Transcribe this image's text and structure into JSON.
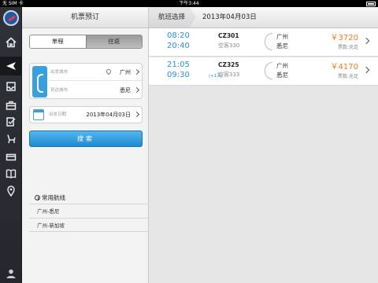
{
  "status_bar": {
    "carrier": "无 SIM 卡",
    "time": "下午3:44"
  },
  "rail": {
    "items": [
      "home-icon",
      "plane-icon",
      "inbox-icon",
      "briefcase-icon",
      "checklist-icon",
      "seat-icon",
      "card-icon",
      "book-icon",
      "location-icon"
    ],
    "user_icon": "user-icon"
  },
  "left_panel": {
    "title": "机票预订",
    "trip_type": {
      "one_way": "单程",
      "round_trip": "往返",
      "selected": "单程"
    },
    "origin": {
      "label": "出发城市",
      "value": "广州"
    },
    "destination": {
      "label": "到达城市",
      "value": "悉尼"
    },
    "departure_date": {
      "label": "出发日期",
      "value": "2013年04月03日"
    },
    "search_label": "搜索",
    "favorites": {
      "title": "常用航线",
      "items": [
        "广州-悉尼",
        "广州-新加坡"
      ]
    }
  },
  "right_panel": {
    "tag": "航班选择",
    "date": "2013年04月03日",
    "flights": [
      {
        "depart": "08:20",
        "arrive": "20:40",
        "nextday": "",
        "code": "CZ301",
        "model": "空客330",
        "from": "广州",
        "to": "悉尼",
        "price": "￥3720",
        "tickets": "票数:充足"
      },
      {
        "depart": "21:05",
        "arrive": "09:30",
        "nextday": "(+1天)",
        "code": "CZ325",
        "model": "空客333",
        "from": "广州",
        "to": "悉尼",
        "price": "￥4170",
        "tickets": "票数:充足"
      }
    ]
  },
  "colors": {
    "accent": "#2a8fd6",
    "price": "#f07b1e",
    "button": "#1e8ad0"
  }
}
